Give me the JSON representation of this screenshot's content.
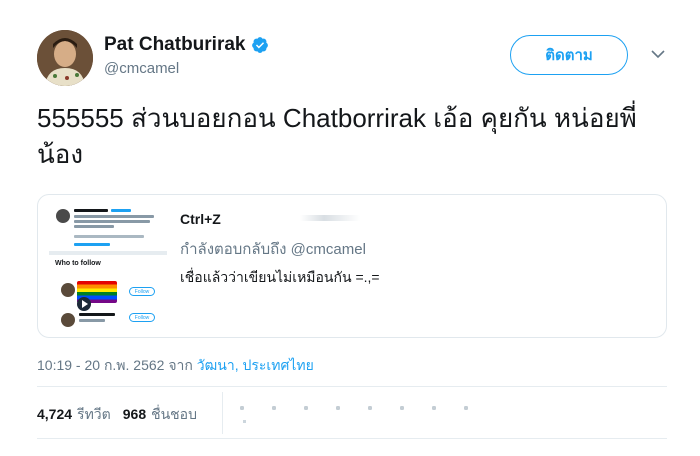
{
  "author": {
    "display_name": "Pat Chatburirak",
    "handle": "@cmcamel",
    "verified": true
  },
  "follow_button_label": "ติดตาม",
  "tweet_text": "555555 ส่วนบอยกอน Chatborrirak เอ้อ คุยกัน หน่อยพี่น้อง",
  "quoted_tweet": {
    "author_name": "Ctrl+Z",
    "reply_to": "กำลังตอบกลับถึง @cmcamel",
    "text": "เชื่อแล้วว่าเขียนไม่เหมือนกัน =.,=",
    "thumbnail": {
      "author_name": "Pat Chatburirak",
      "who_to_follow_title": "Who to follow",
      "follow_label": "Follow"
    }
  },
  "meta": {
    "timestamp": "10:19 - 20 ก.พ. 2562 จาก ",
    "location": "วัฒนา, ประเทศไทย"
  },
  "stats": {
    "retweets_count": "4,724",
    "retweets_label": "รีทวีต",
    "likes_count": "968",
    "likes_label": "ชื่นชอบ"
  },
  "colors": {
    "accent": "#1da1f2",
    "secondary_text": "#657786",
    "border": "#e1e8ed"
  },
  "icons": {
    "verified": "verified-badge-icon",
    "menu": "chevron-down-icon"
  }
}
